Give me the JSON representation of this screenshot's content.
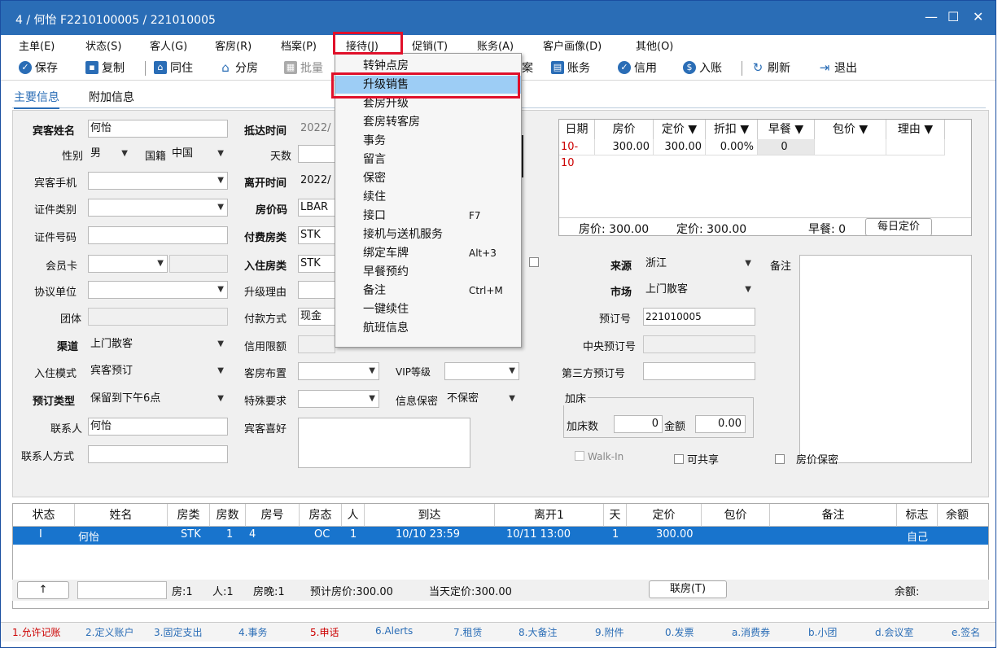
{
  "window": {
    "title": "4 / 何怡 F2210100005 / 221010005",
    "min": "—",
    "max": "☐",
    "close": "✕"
  },
  "menubar": [
    "主单(E)",
    "状态(S)",
    "客人(G)",
    "客房(R)",
    "档案(P)",
    "接待(J)",
    "促销(T)",
    "账务(A)",
    "客户画像(D)",
    "其他(O)"
  ],
  "toolbar": {
    "save": "保存",
    "copy": "复制",
    "cohabit": "同住",
    "split": "分房",
    "batch": "批量",
    "profile_tail": "案",
    "accounts": "账务",
    "credit": "信用",
    "post": "入账",
    "refresh": "刷新",
    "exit": "退出"
  },
  "tabs": {
    "main": "主要信息",
    "extra": "附加信息"
  },
  "left": {
    "guest_name_label": "宾客姓名",
    "guest_name": "何怡",
    "gender_label": "性别",
    "gender": "男",
    "nationality_label": "国籍",
    "nationality": "中国",
    "mobile_label": "宾客手机",
    "id_type_label": "证件类别",
    "id_no_label": "证件号码",
    "member_label": "会员卡",
    "agreement_label": "协议单位",
    "group_label": "团体",
    "channel_label": "渠道",
    "channel": "上门散客",
    "checkin_mode_label": "入住模式",
    "checkin_mode": "宾客预订",
    "booking_type_label": "预订类型",
    "booking_type": "保留到下午6点",
    "contact_label": "联系人",
    "contact": "何怡",
    "contact_method_label": "联系人方式"
  },
  "middle": {
    "arrival_label": "抵达时间",
    "arrival": "2022/",
    "days_label": "天数",
    "departure_label": "离开时间",
    "departure": "2022/",
    "rate_code_label": "房价码",
    "rate_code": "LBAR",
    "paid_type_label": "付费房类",
    "paid_type": "STK",
    "checkin_type_label": "入住房类",
    "checkin_type": "STK",
    "upgrade_reason_label": "升级理由",
    "payment_label": "付款方式",
    "payment": "现金",
    "credit_label": "信用限额",
    "layout_label": "客房布置",
    "special_label": "特殊要求",
    "pref_label": "宾客喜好",
    "vip_label": "VIP等级",
    "privacy_label": "信息保密",
    "privacy": "不保密"
  },
  "rategrid": {
    "headers": [
      "日期",
      "房价",
      "定价 ▼",
      "折扣 ▼",
      "早餐 ▼",
      "包价 ▼",
      "理由 ▼"
    ],
    "row": [
      "10-10",
      "300.00",
      "300.00",
      "0.00%",
      "0"
    ],
    "summary_rate": "房价: 300.00",
    "summary_fixed": "定价: 300.00",
    "summary_bf": "早餐: 0",
    "daily_btn": "每日定价"
  },
  "right": {
    "source_label": "来源",
    "source": "浙江",
    "remark_label": "备注",
    "market_label": "市场",
    "market": "上门散客",
    "booking_no_label": "预订号",
    "booking_no": "221010005",
    "central_label": "中央预订号",
    "third_label": "第三方预订号",
    "extra_bed_label": "加床",
    "bed_count_label": "加床数",
    "bed_count": "0",
    "amount_label": "金额",
    "amount": "0.00",
    "walkin": "Walk-In",
    "shareable": "可共享",
    "rate_secret": "房价保密"
  },
  "list": {
    "headers": [
      "状态",
      "姓名",
      "房类",
      "房数",
      "房号",
      "房态",
      "人",
      "到达",
      "离开1",
      "天",
      "定价",
      "包价",
      "备注",
      "标志",
      "余额"
    ],
    "row": [
      "I",
      "何怡",
      "STK",
      "1",
      "4",
      "OC",
      "1",
      "10/10 23:59",
      "10/11 13:00",
      "1",
      "300.00",
      "",
      "",
      "自己",
      ""
    ]
  },
  "footer": {
    "arrow": "↑",
    "rooms": "房:1",
    "people": "人:1",
    "nights": "房晚:1",
    "est": "预计房价:300.00",
    "today": "当天定价:300.00",
    "link_btn": "联房(T)",
    "balance": "余额:"
  },
  "bottomtabs": [
    "1.允许记账",
    "2.定义账户",
    "3.固定支出",
    "4.事务",
    "5.申话",
    "6.Alerts",
    "7.租赁",
    "8.大备注",
    "9.附件",
    "0.发票",
    "a.消费券",
    "b.小团",
    "d.会议室",
    "e.签名"
  ],
  "menu": [
    {
      "label": "转钟点房",
      "short": ""
    },
    {
      "label": "升级销售",
      "short": ""
    },
    {
      "label": "套房升级",
      "short": ""
    },
    {
      "label": "套房转客房",
      "short": ""
    },
    {
      "label": "事务",
      "short": ""
    },
    {
      "label": "留言",
      "short": ""
    },
    {
      "label": "保密",
      "short": ""
    },
    {
      "label": "续住",
      "short": ""
    },
    {
      "label": "接口",
      "short": "F7"
    },
    {
      "label": "接机与送机服务",
      "short": ""
    },
    {
      "label": "绑定车牌",
      "short": "Alt+3"
    },
    {
      "label": "早餐预约",
      "short": ""
    },
    {
      "label": "备注",
      "short": "Ctrl+M"
    },
    {
      "label": "一键续住",
      "short": ""
    },
    {
      "label": "航班信息",
      "short": ""
    }
  ],
  "colors": {
    "accent": "#2a6db6",
    "highlight": "#9dcdf5",
    "selection": "#1874cd",
    "annotation": "#e0102a"
  }
}
